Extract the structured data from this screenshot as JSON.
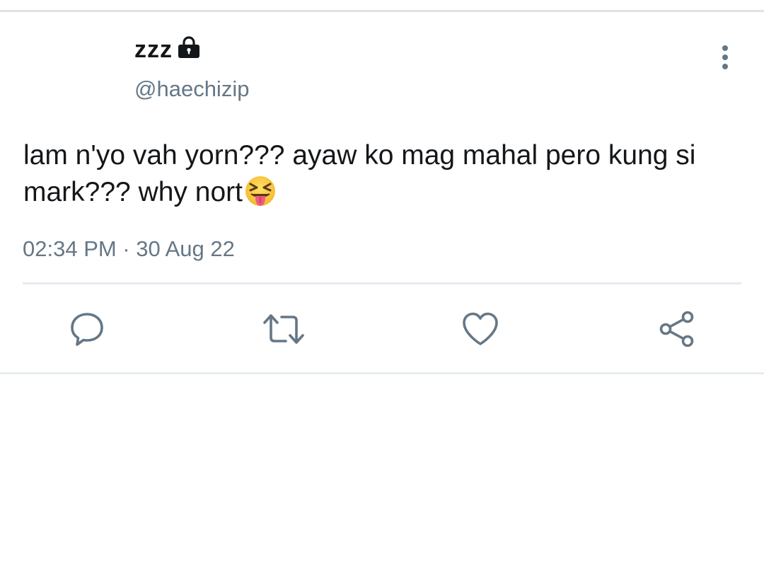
{
  "tweet": {
    "display_name": "zzz",
    "handle": "@haechizip",
    "text": "lam n'yo vah yorn??? ayaw ko mag mahal pero kung si mark??? why nort",
    "emoji": "squinting-face-with-tongue",
    "timestamp": "02:34 PM · 30 Aug 22",
    "protected": true
  },
  "actions": [
    {
      "name": "reply",
      "icon": "reply-icon"
    },
    {
      "name": "retweet",
      "icon": "retweet-icon"
    },
    {
      "name": "like",
      "icon": "heart-icon"
    },
    {
      "name": "share",
      "icon": "share-icon"
    }
  ],
  "colors": {
    "text": "#14171a",
    "secondary": "#657786",
    "divider": "#e6ecf0",
    "icon": "#657786"
  }
}
